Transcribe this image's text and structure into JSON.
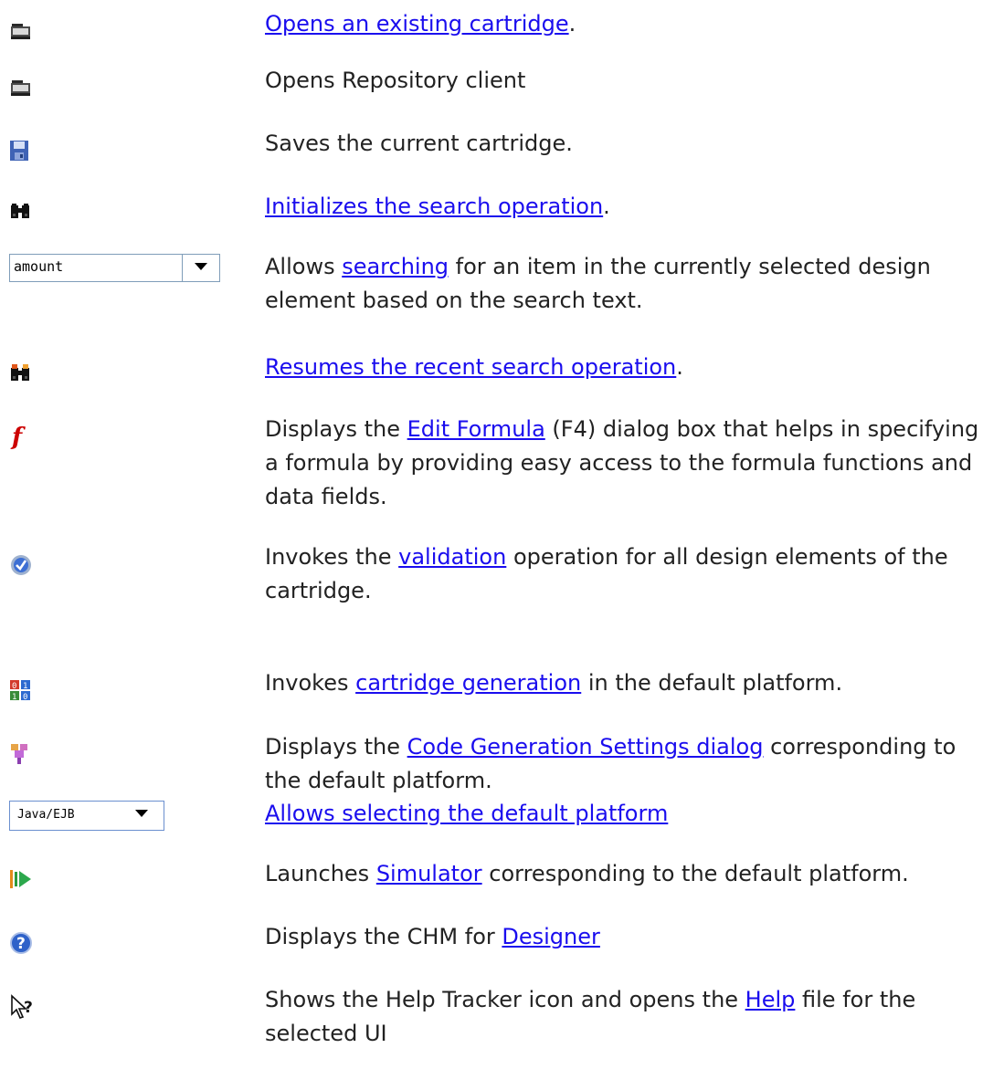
{
  "rows": [
    {
      "icon": "open-folder-icon",
      "parts": [
        {
          "link": "Opens an existing cartridge"
        },
        {
          "text": "."
        }
      ]
    },
    {
      "icon": "open-folder-icon",
      "parts": [
        {
          "text": "Opens Repository client"
        }
      ]
    },
    {
      "icon": "save-disk-icon",
      "parts": [
        {
          "text": "Saves the current cartridge."
        }
      ]
    },
    {
      "icon": "binoculars-icon",
      "parts": [
        {
          "link": "Initializes the search operation"
        },
        {
          "text": "."
        }
      ]
    },
    {
      "combo": "amount",
      "parts": [
        {
          "text": "Allows "
        },
        {
          "link": "searching"
        },
        {
          "text": " for an item in the currently selected design element based on the search text."
        }
      ]
    },
    {
      "icon": "binoculars-resume-icon",
      "parts": [
        {
          "link": "Resumes the recent search operation"
        },
        {
          "text": "."
        }
      ]
    },
    {
      "icon": "formula-icon",
      "parts": [
        {
          "text": "Displays the "
        },
        {
          "link": "Edit Formula"
        },
        {
          "text": " (F4) dialog box that helps in specifying a formula by providing easy access to the formula functions and data fields."
        }
      ]
    },
    {
      "icon": "validate-check-icon",
      "parts": [
        {
          "text": "Invokes the "
        },
        {
          "link": "validation"
        },
        {
          "text": " operation for all design elements of the cartridge."
        }
      ]
    },
    {
      "icon": "generate-binary-icon",
      "parts": [
        {
          "text": "Invokes "
        },
        {
          "link": "cartridge generation"
        },
        {
          "text": " in the default platform."
        }
      ]
    },
    {
      "icon": "code-gen-settings-icon",
      "parts": [
        {
          "text": "Displays the "
        },
        {
          "link": "Code Generation Settings dialog"
        },
        {
          "text": " corresponding to the default platform."
        }
      ]
    },
    {
      "combo": "Java/EJB",
      "parts": [
        {
          "link": "Allows selecting the default platform"
        }
      ]
    },
    {
      "icon": "simulator-launch-icon",
      "parts": [
        {
          "text": "Launches "
        },
        {
          "link": "Simulator"
        },
        {
          "text": " corresponding to the default platform."
        }
      ]
    },
    {
      "icon": "help-question-icon",
      "parts": [
        {
          "text": "Displays the CHM for "
        },
        {
          "link": "Designer"
        }
      ]
    },
    {
      "icon": "help-tracker-icon",
      "parts": [
        {
          "text": "Shows the Help Tracker icon and opens the "
        },
        {
          "link": "Help"
        },
        {
          "text": " file for the selected UI"
        }
      ]
    }
  ]
}
